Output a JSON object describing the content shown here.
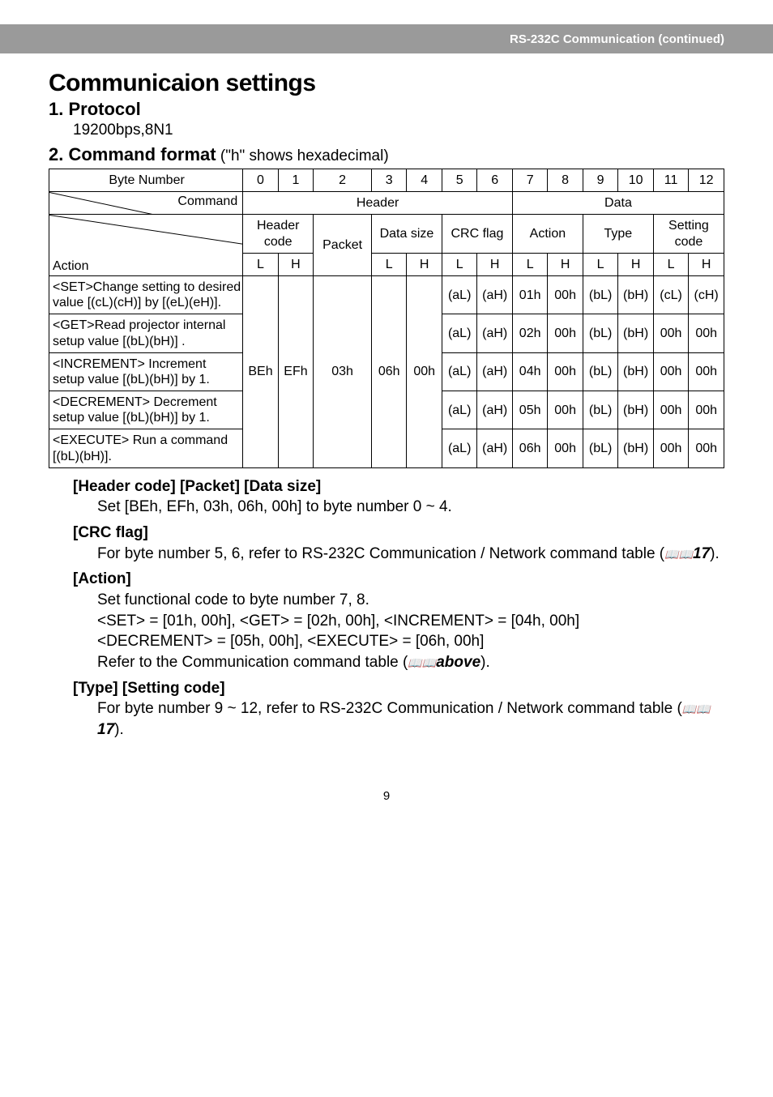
{
  "band": "RS-232C Communication (continued)",
  "h1": "Communicaion settings",
  "h2a": "1. Protocol",
  "proto": "19200bps,8N1",
  "h2b": "2. Command format",
  "h2b_suffix": "  (\"h\" shows hexadecimal)",
  "tbl": {
    "byte_number": "Byte Number",
    "command": "Command",
    "action_lbl": "Action",
    "header": "Header",
    "data": "Data",
    "header_code": "Header code",
    "packet": "Packet",
    "data_size": "Data size",
    "crc_flag": "CRC flag",
    "action": "Action",
    "type": "Type",
    "setting_code": "Setting code",
    "L": "L",
    "H": "H",
    "nums": [
      "0",
      "1",
      "2",
      "3",
      "4",
      "5",
      "6",
      "7",
      "8",
      "9",
      "10",
      "11",
      "12"
    ],
    "fixed": {
      "BEh": "BEh",
      "EFh": "EFh",
      "03h": "03h",
      "06h": "06h",
      "00h": "00h"
    },
    "rows": [
      {
        "desc": "<SET>Change setting to desired value [(cL)(cH)] by [(eL)(eH)].",
        "aL": "(aL)",
        "aH": "(aH)",
        "act_l": "01h",
        "act_h": "00h",
        "type_l": "(bL)",
        "type_h": "(bH)",
        "sc_l": "(cL)",
        "sc_h": "(cH)"
      },
      {
        "desc": "<GET>Read projector internal setup value [(bL)(bH)] .",
        "aL": "(aL)",
        "aH": "(aH)",
        "act_l": "02h",
        "act_h": "00h",
        "type_l": "(bL)",
        "type_h": "(bH)",
        "sc_l": "00h",
        "sc_h": "00h"
      },
      {
        "desc": "<INCREMENT> Increment setup value [(bL)(bH)] by 1.",
        "aL": "(aL)",
        "aH": "(aH)",
        "act_l": "04h",
        "act_h": "00h",
        "type_l": "(bL)",
        "type_h": "(bH)",
        "sc_l": "00h",
        "sc_h": "00h"
      },
      {
        "desc": "<DECREMENT> Decrement setup value [(bL)(bH)] by 1.",
        "aL": "(aL)",
        "aH": "(aH)",
        "act_l": "05h",
        "act_h": "00h",
        "type_l": "(bL)",
        "type_h": "(bH)",
        "sc_l": "00h",
        "sc_h": "00h"
      },
      {
        "desc": "<EXECUTE> Run a command [(bL)(bH)].",
        "aL": "(aL)",
        "aH": "(aH)",
        "act_l": "06h",
        "act_h": "00h",
        "type_l": "(bL)",
        "type_h": "(bH)",
        "sc_l": "00h",
        "sc_h": "00h"
      }
    ]
  },
  "sec": {
    "hdr1": "[Header code] [Packet] [Data size]",
    "hdr1_b": "Set [BEh, EFh, 03h, 06h, 00h] to byte number 0 ~ 4.",
    "hdr2": "[CRC flag]",
    "hdr2_b_pre": "For byte number 5, 6, refer to RS-232C Communication / Network command table (",
    "hdr2_b_ref": "17",
    "hdr2_b_post": ").",
    "hdr3": "[Action]",
    "hdr3_b1": "Set functional code to byte number 7, 8.",
    "hdr3_b2": "<SET> = [01h, 00h], <GET> = [02h, 00h], <INCREMENT> = [04h, 00h]",
    "hdr3_b3": "<DECREMENT> = [05h, 00h], <EXECUTE> = [06h, 00h]",
    "hdr3_b4_pre": "Refer to the Communication command table (",
    "hdr3_b4_ref": "above",
    "hdr3_b4_post": ").",
    "hdr4": "[Type] [Setting code]",
    "hdr4_b_pre": "For byte number 9 ~ 12, refer to RS-232C Communication / Network command table (",
    "hdr4_b_ref": "17",
    "hdr4_b_post": ")."
  },
  "page": "9"
}
